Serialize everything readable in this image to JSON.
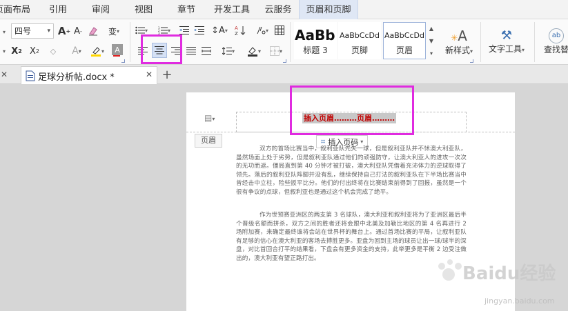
{
  "menu": {
    "tabs": [
      "页面布局",
      "引用",
      "审阅",
      "视图",
      "章节",
      "开发工具",
      "云服务",
      "页眉和页脚"
    ],
    "active_tab": "页眉和页脚"
  },
  "ribbon": {
    "font_size": "四号",
    "styles": [
      {
        "sample": "AaBb(",
        "name": "标题 3"
      },
      {
        "sample": "AaBbCcDd",
        "name": "页脚"
      },
      {
        "sample": "AaBbCcDd",
        "name": "页眉"
      }
    ],
    "new_style_label": "新样式",
    "text_tools_label": "文字工具",
    "find_replace_label": "查找替",
    "colors": {
      "font_red": "#e02020",
      "highlight_yellow": "#ffd700",
      "annotation": "#e02be0"
    }
  },
  "document_tab": {
    "title": "足球分析帖.docx *",
    "add_label": "+"
  },
  "page": {
    "header_text": "插入页眉………页眉………",
    "header_label": "页眉",
    "insert_page_number": "插入页码",
    "paragraphs": [
      "双方的首场比赛当中，叙利亚队先失一球，但是叙利亚队并不怵澳大利亚队，虽然场面上处于劣势，但是叙利亚队通过他们的顽强防守，让澳大利亚人的进攻一次次的无功而返。僵局直到第 40 分钟才被打破，澳大利亚队凭借着充沛体力的逆球取得了领先。落后的叙利亚队阵脚并没有乱，继续保持自己打法的叙利亚队在下半场比赛当中曾经击中立柱，险些扳平比分。他们的付出终将在比赛结束前得到了回报，虽然是一个很有争议的点球，但叙利亚也是通过这个机会完成了绝平。",
      "作为世预赛亚洲区的两支第 3 名球队，澳大利亚和叙利亚将为了亚洲区最后半个晋级名额而拼杀，双方之间的胜者还将会跟中北美及加勒比地区的第 4 名再进行 2 场附加赛，来确定最终谁将会站在世界杯的舞台上。通过首场比赛的平局，让叙利亚队有足够的信心在澳大利亚的客场去搏胜更多。亚盘为回到主场的球员让出一球/球半的深盘，对比首回合打平的结果看，下盘会有更多资金的支持，此举更多是平衡 2 边受注做出的，澳大利亚有望正路打出。"
    ]
  },
  "watermark": {
    "brand": "Baidu经验",
    "url": "jingyan.baidu.com"
  }
}
